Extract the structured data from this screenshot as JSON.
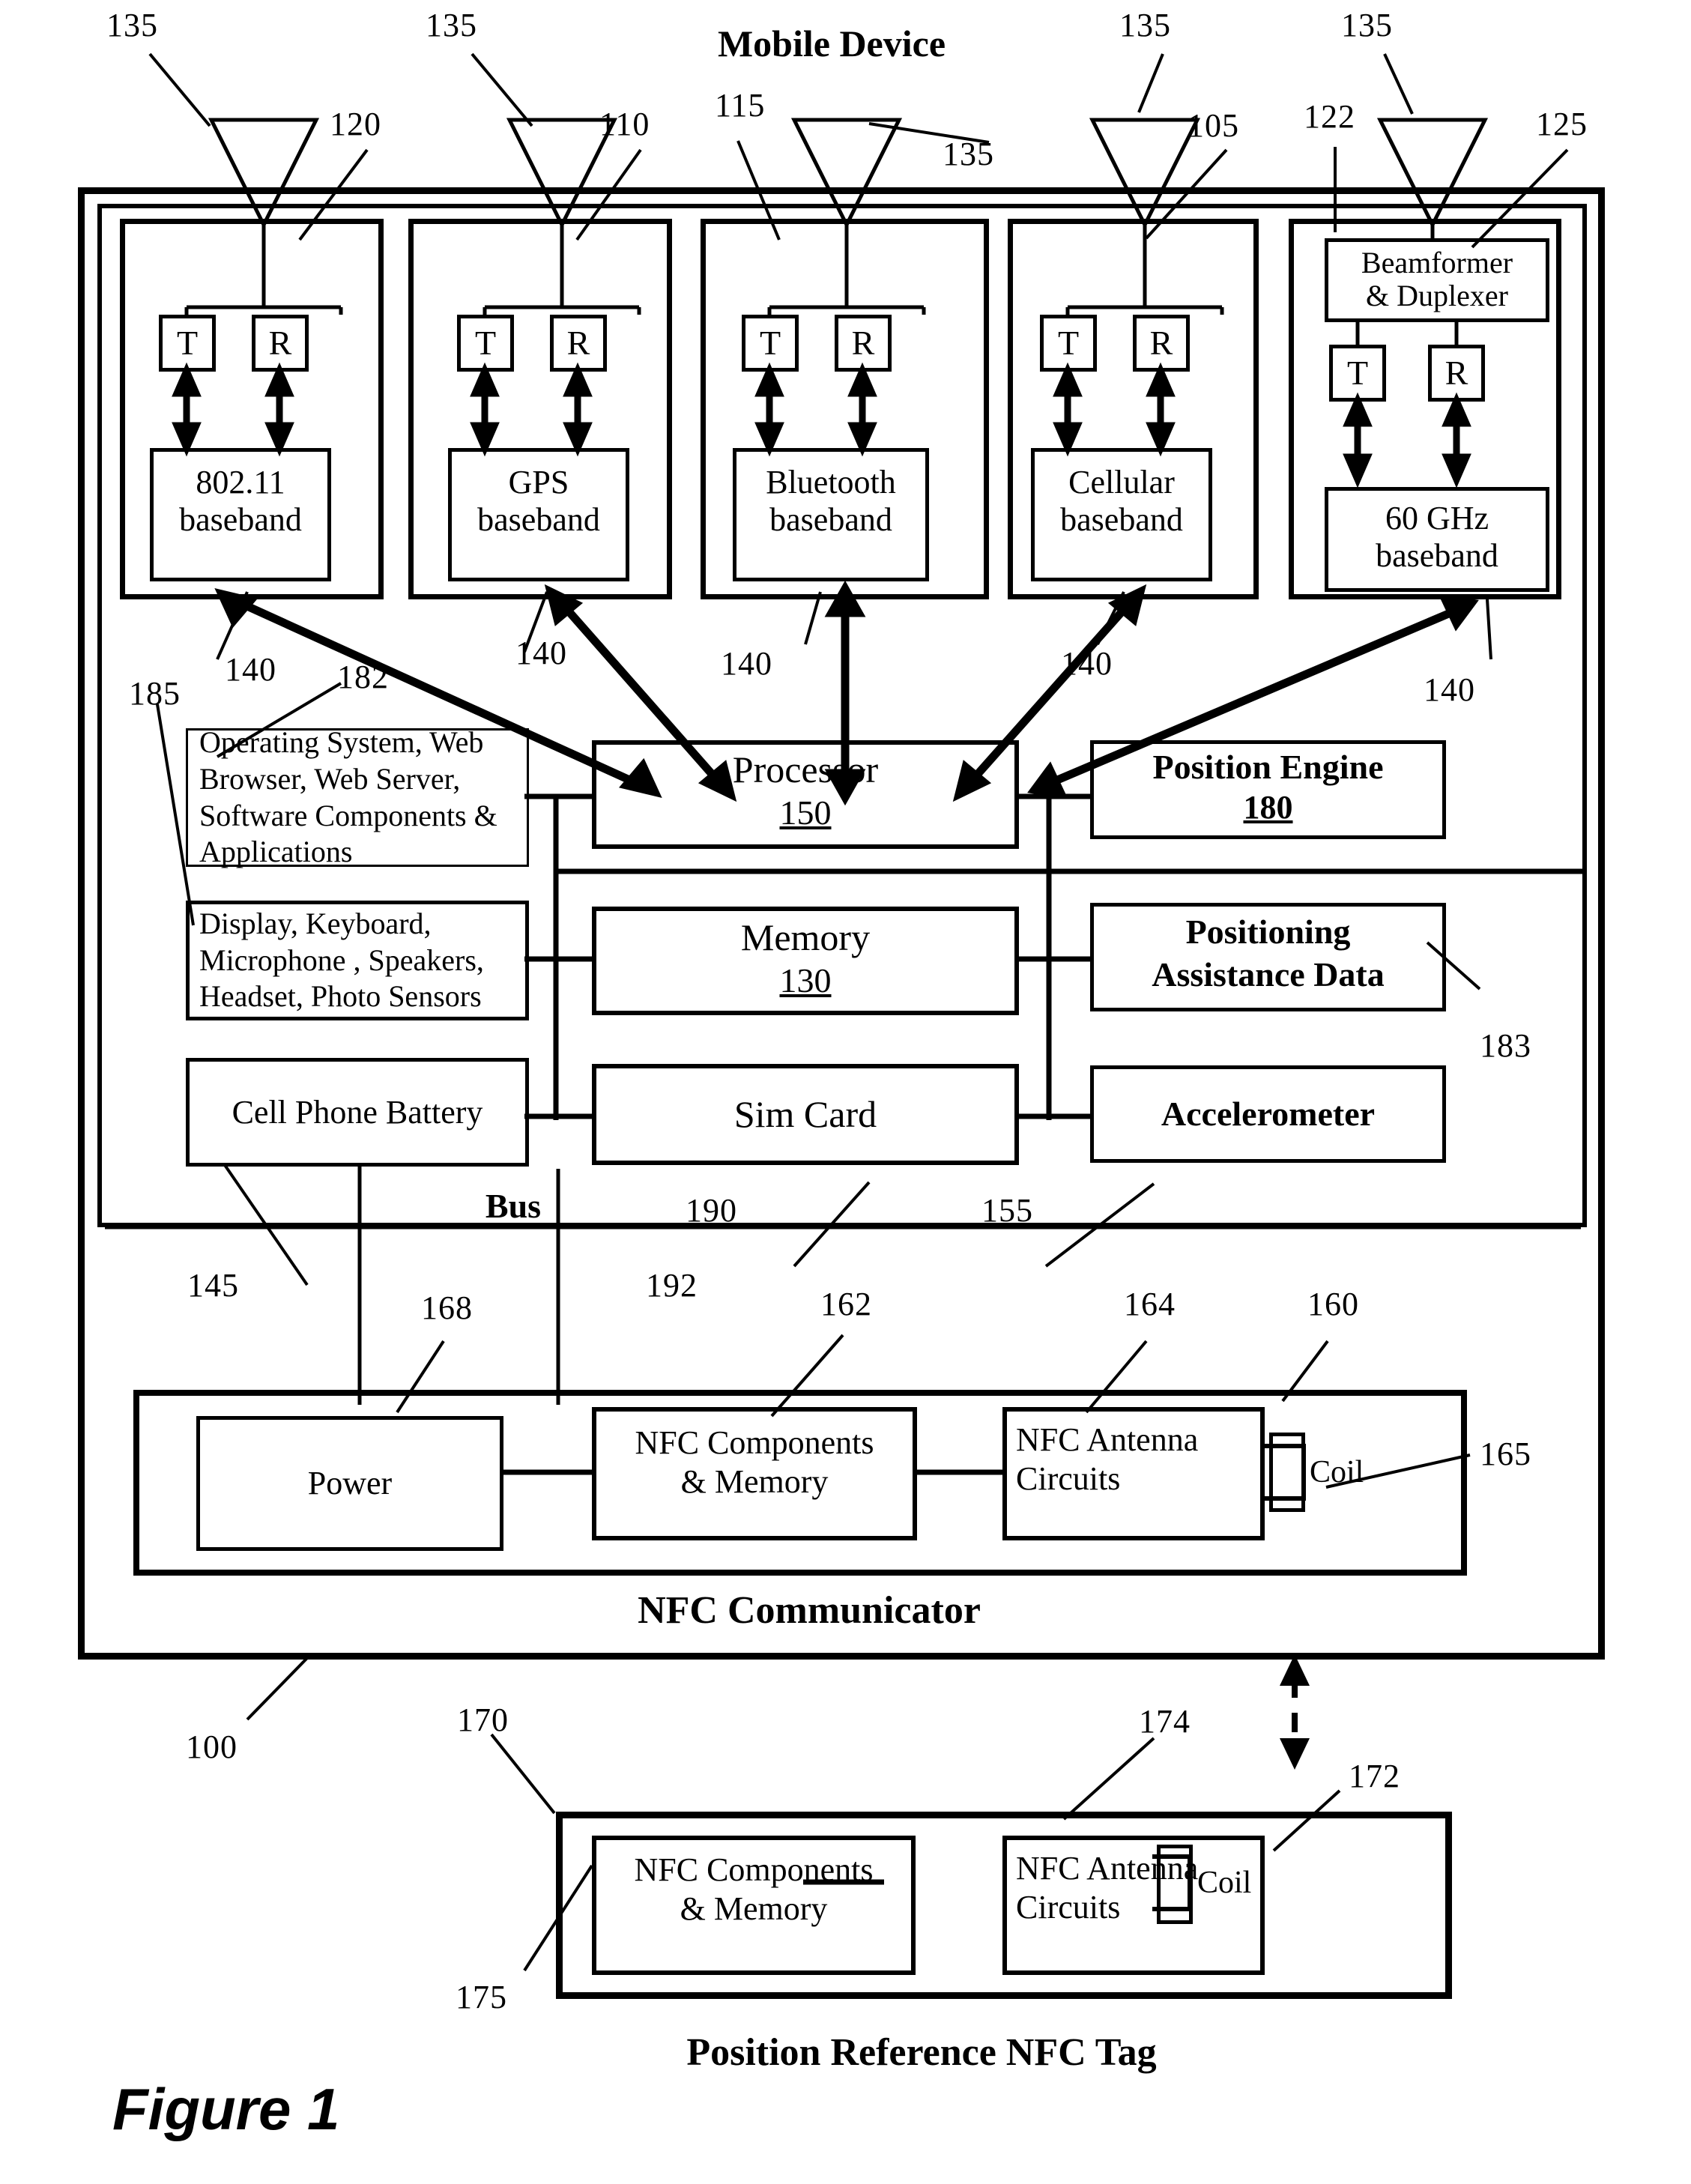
{
  "figure": {
    "caption": "Figure 1",
    "device_title": "Mobile Device",
    "tag_title": "Position Reference NFC Tag",
    "nfc_comm_title": "NFC Communicator",
    "bus_label": "Bus"
  },
  "radios": [
    {
      "module_ref": "120",
      "antenna_ref": "135",
      "tx": "T",
      "rx": "R",
      "baseband": "802.11\nbaseband",
      "bb_ref": "140"
    },
    {
      "module_ref": "110",
      "antenna_ref": "135",
      "tx": "T",
      "rx": "R",
      "baseband": "GPS\nbaseband",
      "bb_ref": "140"
    },
    {
      "module_ref": "115",
      "antenna_ref": "135",
      "tx": "T",
      "rx": "R",
      "baseband": "Bluetooth\nbaseband",
      "bb_ref": "140"
    },
    {
      "module_ref": "105",
      "antenna_ref": "135",
      "tx": "T",
      "rx": "R",
      "baseband": "Cellular\nbaseband",
      "bb_ref": "140"
    },
    {
      "module_ref": "125",
      "antenna_ref": "135",
      "tx": "T",
      "rx": "R",
      "baseband": "60 GHz\nbaseband",
      "bb_ref": "140",
      "beamformer": "Beamformer\n& Duplexer",
      "beamformer_ref": "122"
    }
  ],
  "radio_labels": {
    "bb_802": "802.11",
    "bb_gps": "GPS",
    "bb_bt": "Bluetooth",
    "bb_cell": "Cellular",
    "bb_60": "60 GHz",
    "baseband_word": "baseband",
    "beamformer_l1": "Beamformer",
    "beamformer_l2": "& Duplexer",
    "tx": "T",
    "rx": "R"
  },
  "system": {
    "software": {
      "text": "Operating System, Web Browser, Web Server, Software Components & Applications",
      "ref": "182"
    },
    "peripherals": {
      "text": "Display, Keyboard, Microphone , Speakers, Headset, Photo Sensors",
      "ref": "185"
    },
    "battery": {
      "text": "Cell Phone Battery",
      "ref": "145"
    },
    "processor": {
      "name": "Processor",
      "num": "150"
    },
    "memory": {
      "name": "Memory",
      "num": "130"
    },
    "simcard": {
      "name": "Sim Card",
      "ref": "190"
    },
    "position_engine": {
      "name": "Position Engine",
      "num": "180"
    },
    "assistance": {
      "l1": "Positioning",
      "l2": "Assistance Data",
      "ref": "183"
    },
    "accelerometer": {
      "name": "Accelerometer",
      "ref": "155"
    }
  },
  "nfc_communicator": {
    "ref": "160",
    "bus_ref": "192",
    "power": {
      "name": "Power",
      "ref": "168"
    },
    "components": {
      "l1": "NFC Components",
      "l2": "& Memory",
      "ref": "162"
    },
    "antenna": {
      "l1": "NFC Antenna",
      "l2": "Circuits",
      "ref": "164"
    },
    "coil": {
      "name": "Coil",
      "ref": "165"
    }
  },
  "nfc_tag": {
    "outer_ref": "170",
    "components": {
      "l1": "NFC Components",
      "l2": "& Memory",
      "ref": "175"
    },
    "antenna": {
      "l1": "NFC Antenna",
      "l2": "Circuits",
      "ref": "174"
    },
    "coil": {
      "name": "Coil",
      "ref": "172"
    }
  },
  "device_ref": "100"
}
